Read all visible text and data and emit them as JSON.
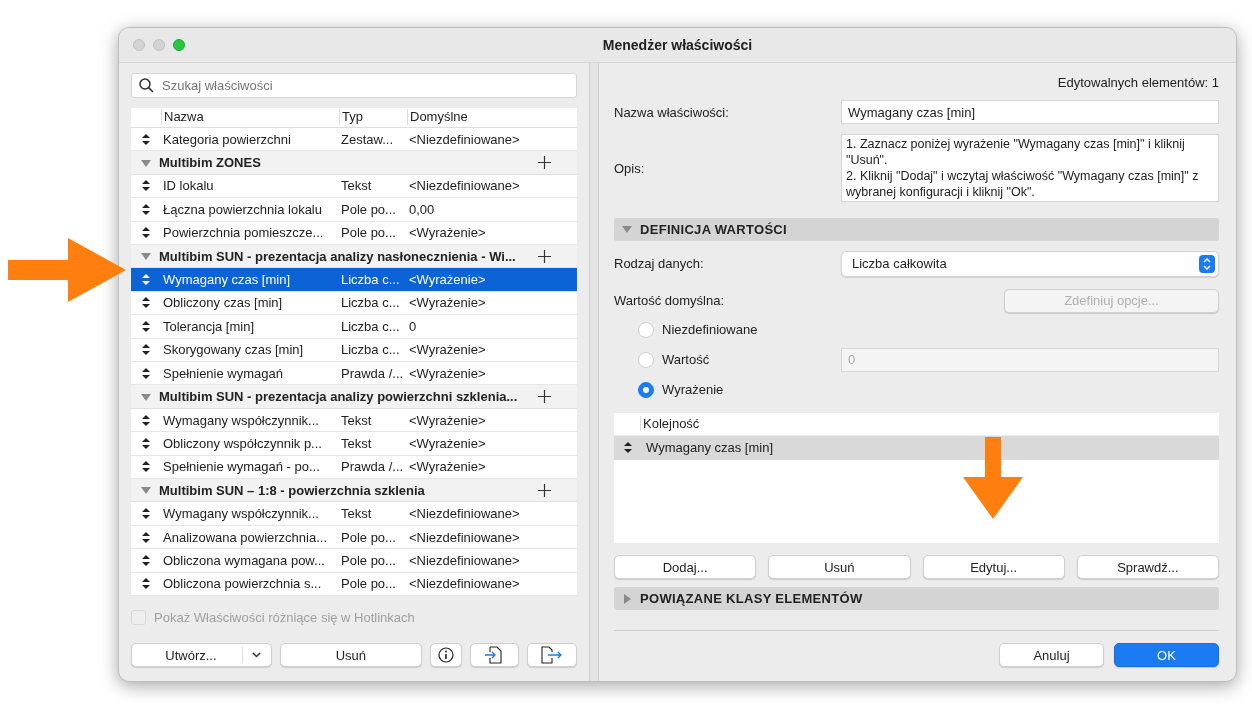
{
  "window": {
    "title": "Menedżer właściwości"
  },
  "search": {
    "placeholder": "Szukaj właściwości"
  },
  "table": {
    "columns": [
      "Nazwa",
      "Typ",
      "Domyślne"
    ],
    "rows": [
      {
        "kind": "property",
        "name": "Kategoria powierzchni",
        "type": "Zestaw...",
        "default": "<Niezdefiniowane>",
        "selected": false
      },
      {
        "kind": "group",
        "name": "Multibim ZONES",
        "expanded": true
      },
      {
        "kind": "property",
        "name": "ID lokalu",
        "type": "Tekst",
        "default": "<Niezdefiniowane>",
        "selected": false
      },
      {
        "kind": "property",
        "name": "Łączna powierzchnia lokalu",
        "type": "Pole po...",
        "default": "0,00",
        "selected": false
      },
      {
        "kind": "property",
        "name": "Powierzchnia pomieszcze...",
        "type": "Pole po...",
        "default": "<Wyrażenie>",
        "selected": false
      },
      {
        "kind": "group",
        "name": "Multibim SUN - prezentacja analizy nasłonecznienia - Wi...",
        "expanded": true
      },
      {
        "kind": "property",
        "name": "Wymagany czas [min]",
        "type": "Liczba c...",
        "default": "<Wyrażenie>",
        "selected": true
      },
      {
        "kind": "property",
        "name": "Obliczony czas [min]",
        "type": "Liczba c...",
        "default": "<Wyrażenie>",
        "selected": false
      },
      {
        "kind": "property",
        "name": "Tolerancja [min]",
        "type": "Liczba c...",
        "default": "0",
        "selected": false
      },
      {
        "kind": "property",
        "name": "Skorygowany czas [min]",
        "type": "Liczba c...",
        "default": "<Wyrażenie>",
        "selected": false
      },
      {
        "kind": "property",
        "name": "Spełnienie wymagań",
        "type": "Prawda /...",
        "default": "<Wyrażenie>",
        "selected": false
      },
      {
        "kind": "group",
        "name": "Multibim SUN - prezentacja analizy powierzchni szklenia...",
        "expanded": true
      },
      {
        "kind": "property",
        "name": "Wymagany współczynnik...",
        "type": "Tekst",
        "default": "<Wyrażenie>",
        "selected": false
      },
      {
        "kind": "property",
        "name": "Obliczony współczynnik p...",
        "type": "Tekst",
        "default": "<Wyrażenie>",
        "selected": false
      },
      {
        "kind": "property",
        "name": "Spełnienie wymagań - po...",
        "type": "Prawda /...",
        "default": "<Wyrażenie>",
        "selected": false
      },
      {
        "kind": "group",
        "name": "Multibim SUN – 1:8 - powierzchnia szklenia",
        "expanded": true
      },
      {
        "kind": "property",
        "name": "Wymagany współczynnik...",
        "type": "Tekst",
        "default": "<Niezdefiniowane>",
        "selected": false
      },
      {
        "kind": "property",
        "name": "Analizowana powierzchnia...",
        "type": "Pole po...",
        "default": "<Niezdefiniowane>",
        "selected": false
      },
      {
        "kind": "property",
        "name": "Obliczona wymagana pow...",
        "type": "Pole po...",
        "default": "<Niezdefiniowane>",
        "selected": false
      },
      {
        "kind": "property",
        "name": "Obliczona powierzchnia s...",
        "type": "Pole po...",
        "default": "<Niezdefiniowane>",
        "selected": false
      }
    ]
  },
  "hotlinks_checkbox": {
    "label": "Pokaż Właściwości różniące się w Hotlinkach",
    "checked": false,
    "disabled": true
  },
  "left_buttons": {
    "create": "Utwórz...",
    "delete": "Usuń"
  },
  "editable_count": "Edytowalnych elementów: 1",
  "name_field": {
    "label": "Nazwa właściwości:",
    "value": "Wymagany czas [min]"
  },
  "description": {
    "label": "Opis:",
    "value": "1. Zaznacz poniżej wyrażenie \"Wymagany czas [min]\" i kliknij \"Usuń\".\n2. Kliknij \"Dodaj\" i wczytaj właściwość \"Wymagany czas [min]\" z wybranej konfiguracji i kliknij \"Ok\"."
  },
  "value_definition": {
    "title": "DEFINICJA WARTOŚCI",
    "expanded": true,
    "data_type": {
      "label": "Rodzaj danych:",
      "value": "Liczba całkowita"
    },
    "default_value": {
      "label": "Wartość domyślna:",
      "define_button": "Zdefiniuj opcje...",
      "define_disabled": true
    },
    "options": [
      {
        "label": "Niezdefiniowane",
        "selected": false
      },
      {
        "label": "Wartość",
        "selected": false
      },
      {
        "label": "Wyrażenie",
        "selected": true
      }
    ],
    "value_field": {
      "value": "0",
      "disabled": true
    },
    "expression_table": {
      "column": "Kolejność",
      "rows": [
        {
          "name": "Wymagany czas [min]",
          "selected": true
        }
      ]
    },
    "buttons": [
      "Dodaj...",
      "Usuń",
      "Edytuj...",
      "Sprawdź..."
    ]
  },
  "related_classes": {
    "title": "POWIĄZANE KLASY ELEMENTÓW",
    "expanded": false
  },
  "dialog_buttons": [
    {
      "label": "Anuluj",
      "kind": "cancel"
    },
    {
      "label": "OK",
      "kind": "default"
    }
  ]
}
